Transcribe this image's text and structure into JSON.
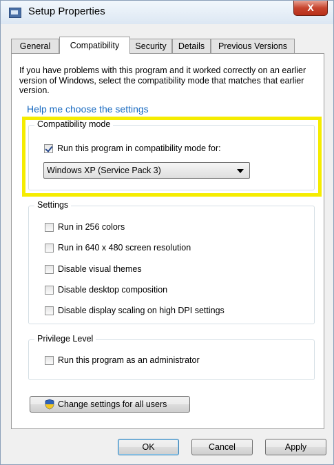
{
  "window": {
    "title": "Setup Properties",
    "close_label": "X"
  },
  "tabs": [
    {
      "label": "General"
    },
    {
      "label": "Compatibility"
    },
    {
      "label": "Security"
    },
    {
      "label": "Details"
    },
    {
      "label": "Previous Versions"
    }
  ],
  "intro_text": "If you have problems with this program and it worked correctly on an earlier version of Windows, select the compatibility mode that matches that earlier version.",
  "help_link": "Help me choose the settings",
  "compat_mode": {
    "label": "Compatibility mode",
    "checkbox_label": "Run this program in compatibility mode for:",
    "checked": true,
    "selected_os": "Windows XP (Service Pack 3)"
  },
  "settings": {
    "label": "Settings",
    "options": [
      {
        "label": "Run in 256 colors",
        "checked": false
      },
      {
        "label": "Run in 640 x 480 screen resolution",
        "checked": false
      },
      {
        "label": "Disable visual themes",
        "checked": false
      },
      {
        "label": "Disable desktop composition",
        "checked": false
      },
      {
        "label": "Disable display scaling on high DPI settings",
        "checked": false
      }
    ]
  },
  "privilege": {
    "label": "Privilege Level",
    "checkbox_label": "Run this program as an administrator",
    "checked": false
  },
  "change_all_users_label": "Change settings for all users",
  "buttons": {
    "ok": "OK",
    "cancel": "Cancel",
    "apply": "Apply"
  },
  "colors": {
    "highlight": "#f5ec00",
    "link": "#1a6bc1"
  }
}
